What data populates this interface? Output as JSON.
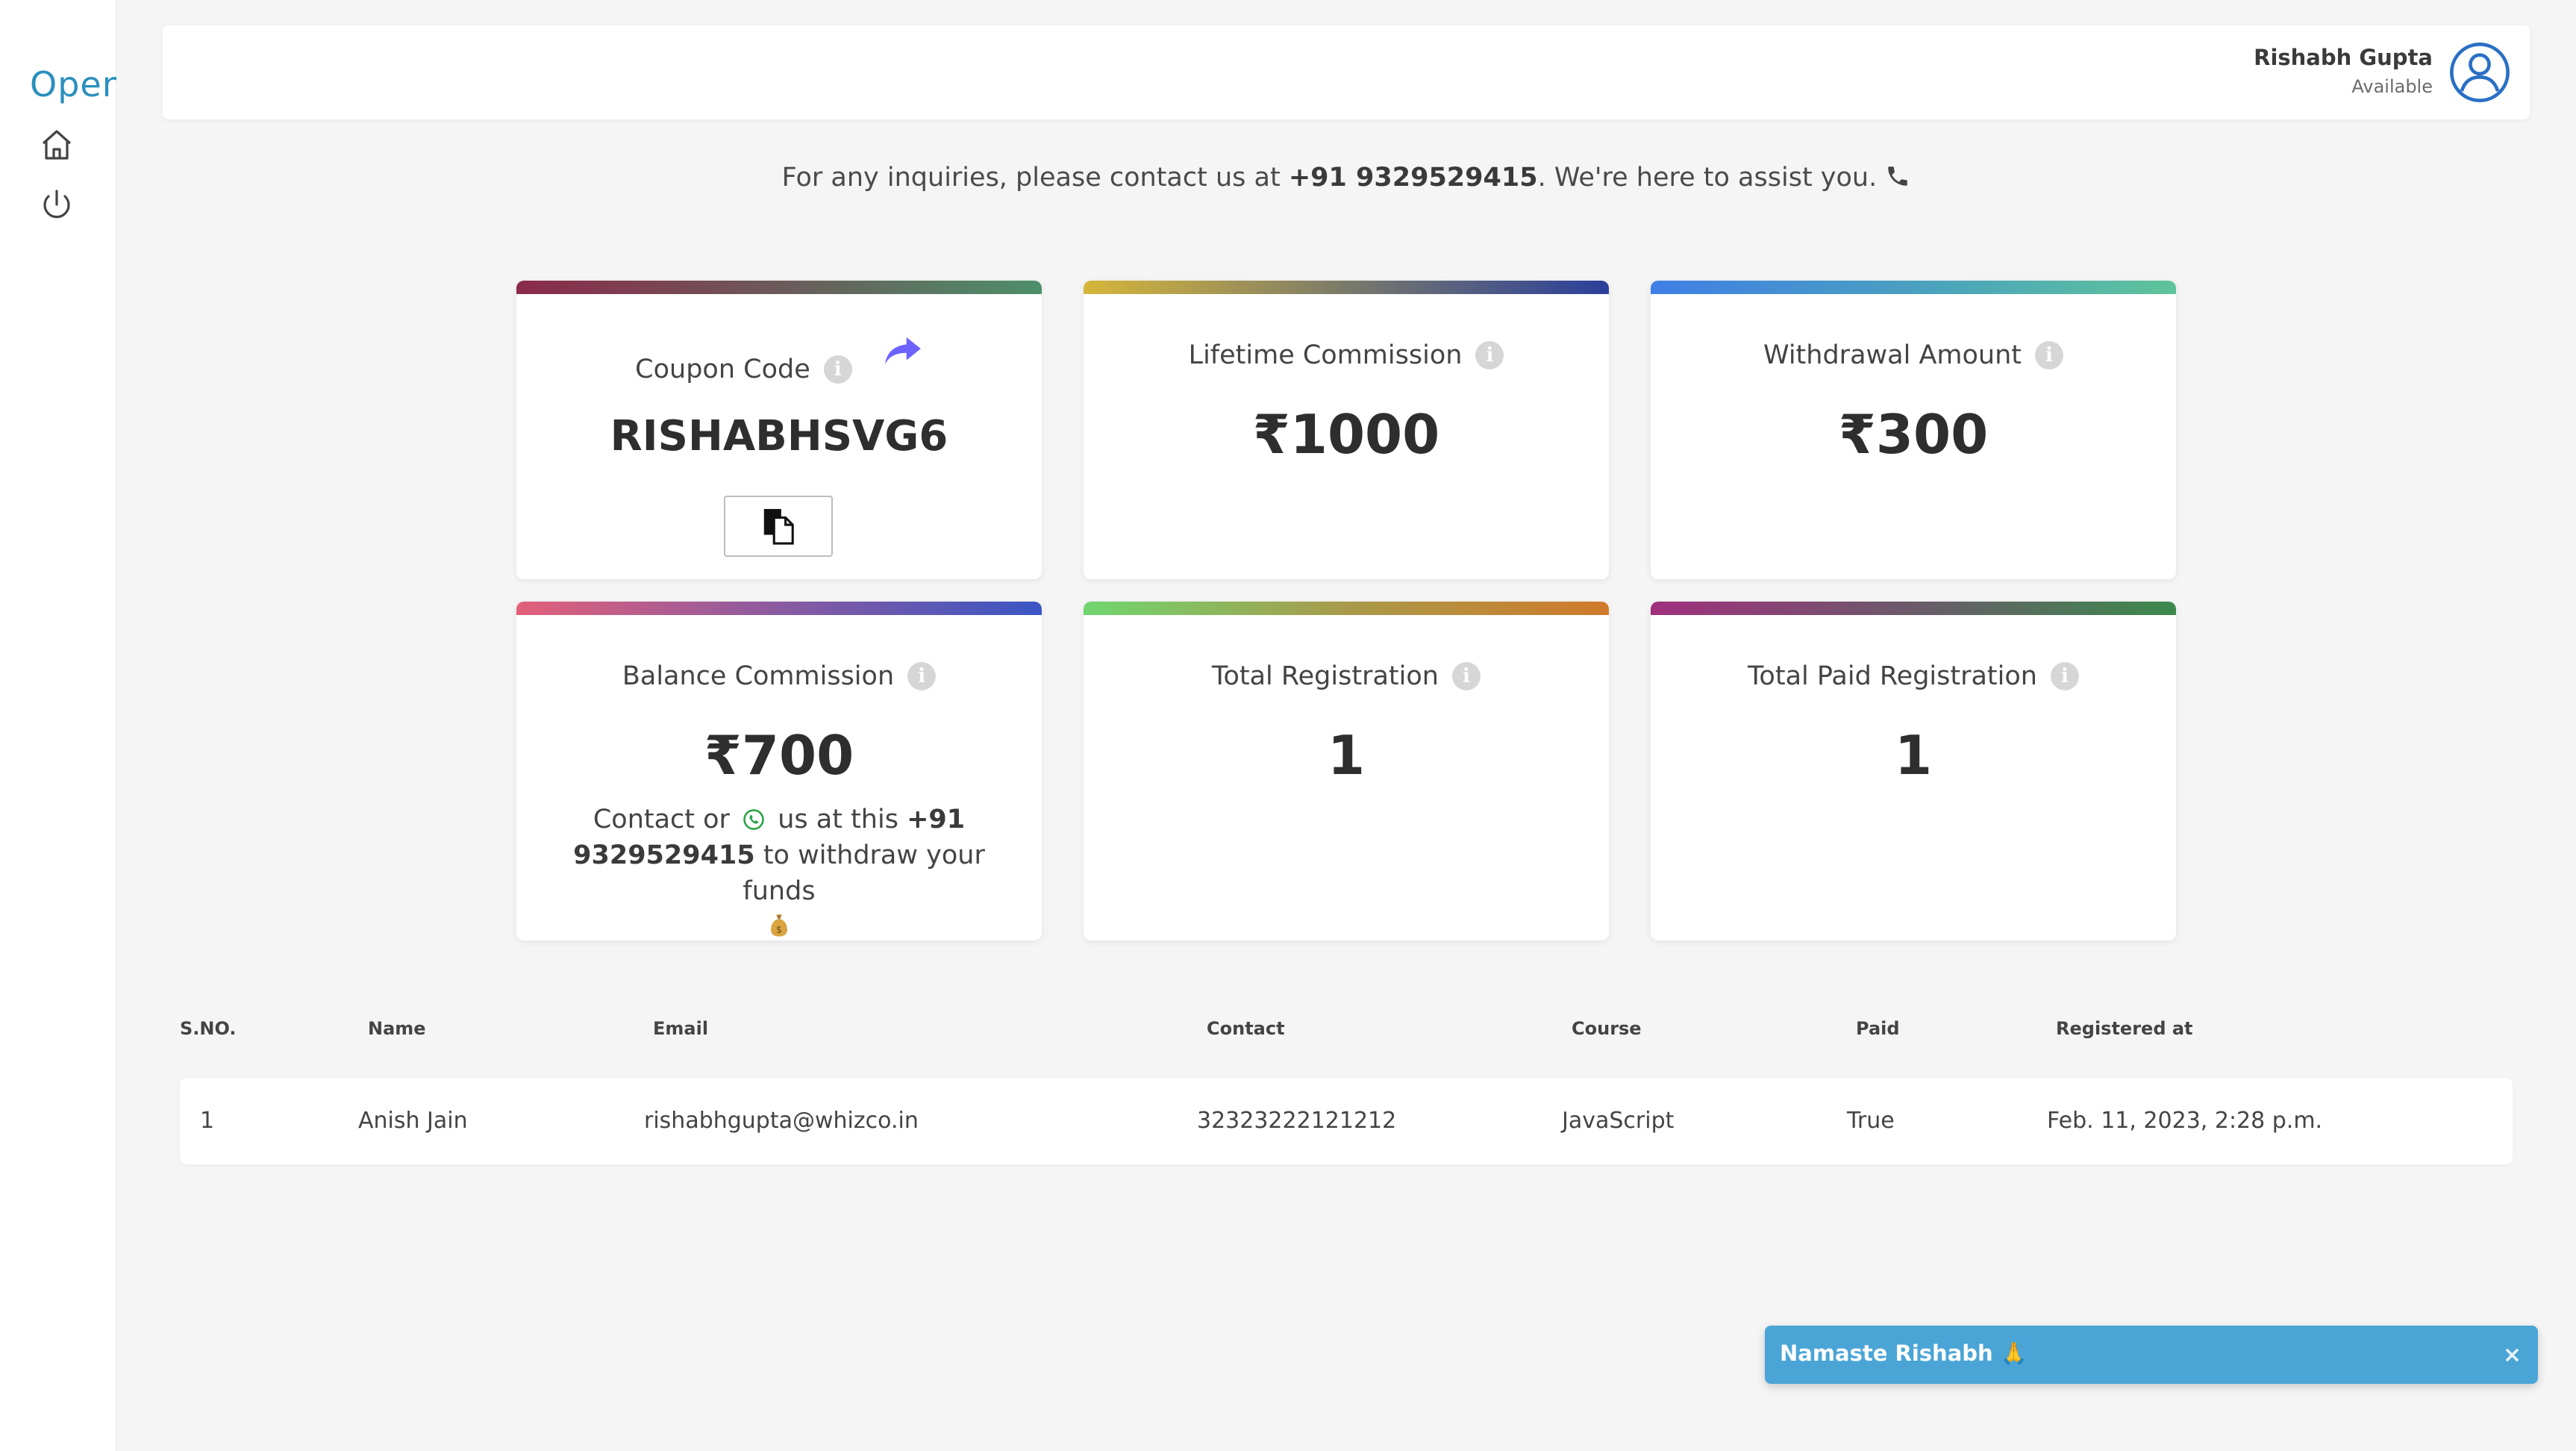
{
  "app": {
    "logo_text": "Open"
  },
  "sidebar": {
    "items": [
      {
        "icon": "home-icon"
      },
      {
        "icon": "power-icon"
      }
    ]
  },
  "header": {
    "user_name": "Rishabh Gupta",
    "user_status": "Available",
    "avatar_icon": "user-circle-icon"
  },
  "inquiry": {
    "prefix": "For any inquiries, please contact us at ",
    "phone": "+91 9329529415",
    "suffix": ". We're here to assist you.",
    "icon": "phone-icon"
  },
  "cards": {
    "coupon": {
      "title": "Coupon Code",
      "value": "RISHABHSVG6",
      "share_icon": "share-icon",
      "copy_icon": "copy-icon",
      "gradient": [
        "#8b2a4a",
        "#4d8f6a"
      ]
    },
    "lifetime": {
      "title": "Lifetime Commission",
      "value": "₹1000",
      "gradient": [
        "#d6b63a",
        "#2a3f9c"
      ]
    },
    "withdrawal": {
      "title": "Withdrawal Amount",
      "value": "₹300",
      "gradient": [
        "#3f7fe6",
        "#5ec49a"
      ]
    },
    "balance": {
      "title": "Balance Commission",
      "value": "₹700",
      "contact_prefix": "Contact or",
      "contact_middle": "us at this",
      "contact_phone": "+91 9329529415",
      "contact_suffix": "to withdraw your funds",
      "gradient": [
        "#e2607a",
        "#3a56c4"
      ]
    },
    "total_registration": {
      "title": "Total Registration",
      "value": "1",
      "gradient": [
        "#6fd66f",
        "#d07a2a"
      ]
    },
    "total_paid_registration": {
      "title": "Total Paid Registration",
      "value": "1",
      "gradient": [
        "#a0307e",
        "#3c8a4c"
      ]
    }
  },
  "table": {
    "headers": [
      "S.NO.",
      "Name",
      "Email",
      "Contact",
      "Course",
      "Paid",
      "Registered at"
    ],
    "rows": [
      [
        "1",
        "Anish Jain",
        "rishabhgupta@whizco.in",
        "32323222121212",
        "JavaScript",
        "True",
        "Feb. 11, 2023, 2:28 p.m."
      ]
    ]
  },
  "toast": {
    "message": "Namaste Rishabh 🙏",
    "close_label": "×"
  },
  "colors": {
    "toast_bg": "#4aa5d6",
    "logo": "#2a8fbd",
    "share_icon": "#6c63ff"
  }
}
